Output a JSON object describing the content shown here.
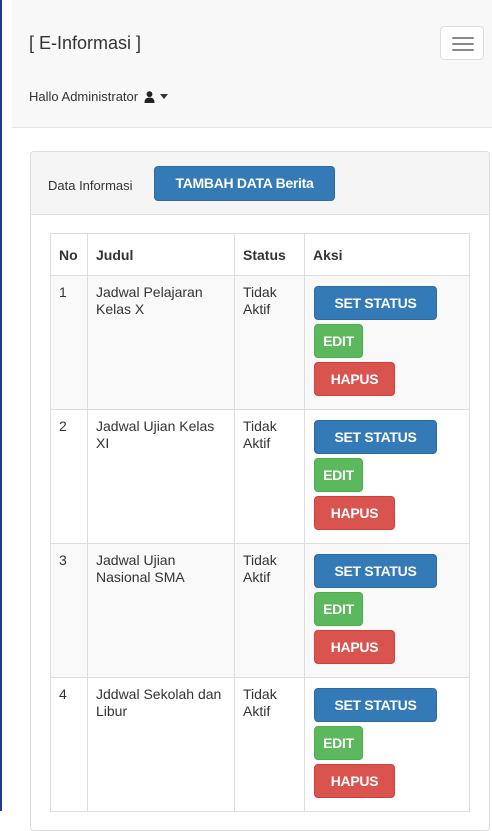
{
  "navbar": {
    "brand": "[ E-Informasi ]",
    "greeting": "Hallo Administrator",
    "user_icon": "user-icon",
    "toggle_icon": "hamburger-menu-icon"
  },
  "panel": {
    "title": "Data Informasi",
    "add_button": "TAMBAH DATA Berita"
  },
  "table": {
    "headers": {
      "no": "No",
      "judul": "Judul",
      "status": "Status",
      "aksi": "Aksi"
    },
    "actions": {
      "set_status": "SET STATUS",
      "edit": "EDIT",
      "hapus": "HAPUS"
    },
    "rows": [
      {
        "no": "1",
        "judul": "Jadwal Pelajaran Kelas X",
        "status": "Tidak Aktif"
      },
      {
        "no": "2",
        "judul": "Jadwal Ujian Kelas XI",
        "status": "Tidak Aktif"
      },
      {
        "no": "3",
        "judul": "Jadwal Ujian Nasional SMA",
        "status": "Tidak Aktif"
      },
      {
        "no": "4",
        "judul": "Jddwal Sekolah dan Libur",
        "status": "Tidak Aktif"
      }
    ]
  },
  "colors": {
    "primary": "#337ab7",
    "success": "#5cb85c",
    "danger": "#d9534f",
    "navbar_bg": "#f8f8f8",
    "panel_heading_bg": "#f5f5f5"
  }
}
